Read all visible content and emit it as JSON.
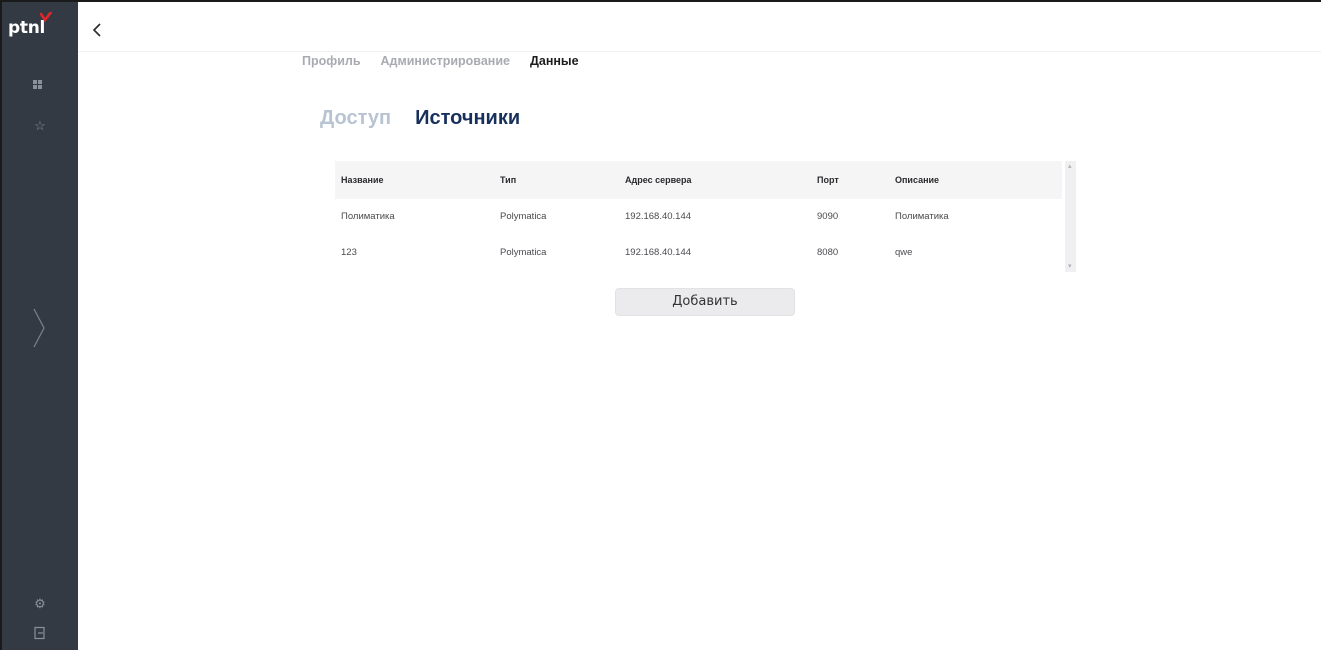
{
  "app": {
    "logo_text": "ptnl",
    "brand_color": "#e0262a"
  },
  "sidebar": {
    "icons": [
      "dashboard-icon",
      "star-icon",
      "expand-chevron-icon",
      "settings-gear-icon",
      "logout-icon"
    ]
  },
  "nav": {
    "items": [
      {
        "label": "Профиль",
        "active": false
      },
      {
        "label": "Администрирование",
        "active": false
      },
      {
        "label": "Данные",
        "active": true
      }
    ]
  },
  "subtabs": {
    "items": [
      {
        "label": "Доступ",
        "active": false
      },
      {
        "label": "Источники",
        "active": true
      }
    ]
  },
  "table": {
    "columns": [
      "Название",
      "Тип",
      "Адрес сервера",
      "Порт",
      "Описание"
    ],
    "rows": [
      [
        "Полиматика",
        "Polymatica",
        "192.168.40.144",
        "9090",
        "Полиматика"
      ],
      [
        "123",
        "Polymatica",
        "192.168.40.144",
        "8080",
        "qwe"
      ]
    ]
  },
  "actions": {
    "add_label": "Добавить"
  }
}
